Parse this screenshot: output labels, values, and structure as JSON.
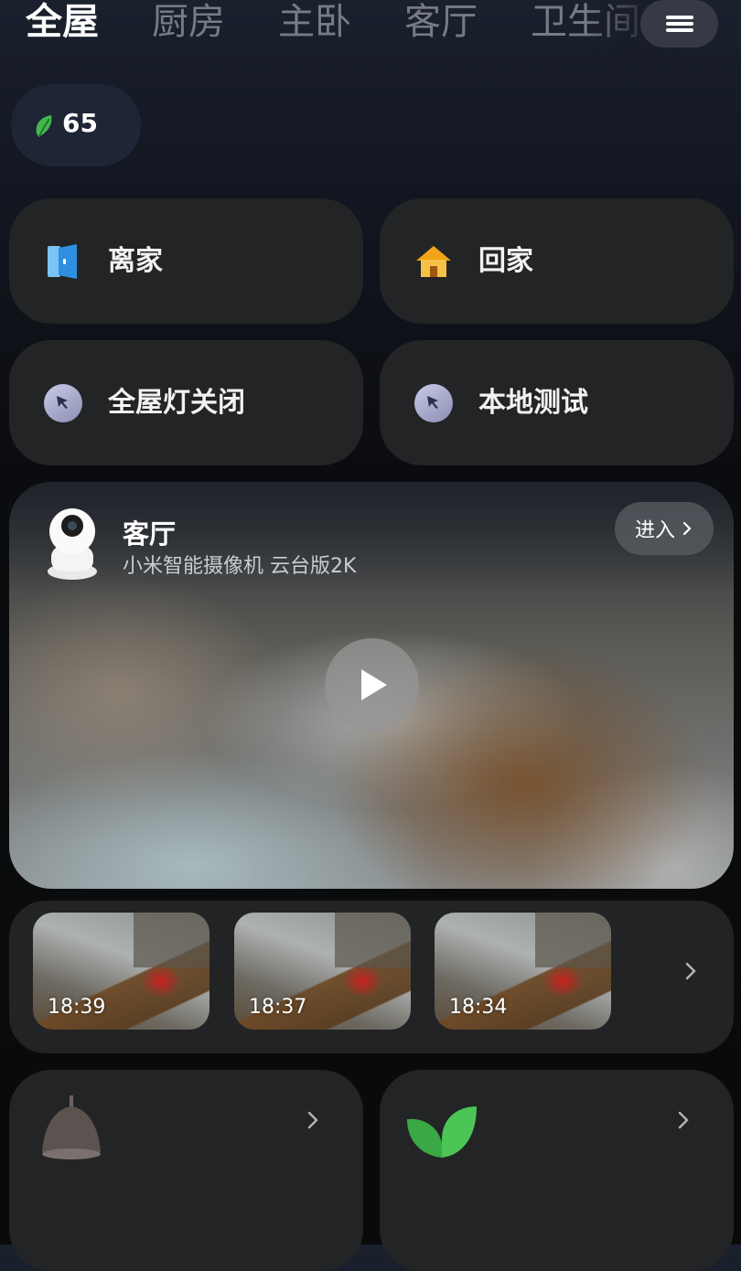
{
  "tabs": [
    {
      "label": "全屋",
      "active": true
    },
    {
      "label": "厨房",
      "active": false
    },
    {
      "label": "主卧",
      "active": false
    },
    {
      "label": "客厅",
      "active": false
    },
    {
      "label": "卫生间",
      "active": false
    }
  ],
  "menu": {
    "icon": "hamburger-menu-icon"
  },
  "env_score": {
    "value": "65",
    "icon": "leaf-icon"
  },
  "scenes": [
    {
      "label": "离家",
      "icon": "door-icon"
    },
    {
      "label": "回家",
      "icon": "house-icon"
    },
    {
      "label": "全屋灯关闭",
      "icon": "cursor-tap-icon"
    },
    {
      "label": "本地测试",
      "icon": "cursor-tap-icon"
    }
  ],
  "camera": {
    "room": "客厅",
    "device": "小米智能摄像机 云台版2K",
    "enter_label": "进入",
    "icon": "camera-device-icon"
  },
  "recordings": [
    {
      "time": "18:39"
    },
    {
      "time": "18:37"
    },
    {
      "time": "18:34"
    }
  ],
  "bottom_cards": [
    {
      "icon": "pendant-lamp-icon"
    },
    {
      "icon": "green-leaf-icon"
    }
  ],
  "colors": {
    "accent_green": "#3fb34a",
    "card_bg": "#232425",
    "house_yellow": "#f2b431",
    "door_blue": "#4ea5ea"
  }
}
